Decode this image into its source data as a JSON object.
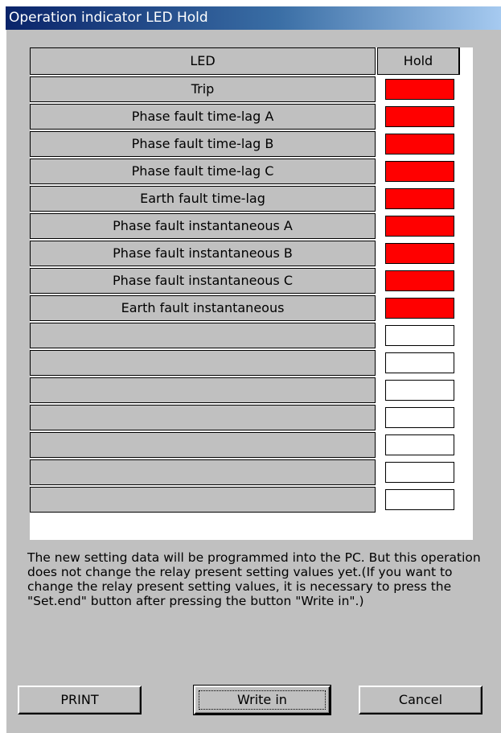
{
  "window": {
    "title": "Operation indicator LED Hold"
  },
  "table": {
    "header_led": "LED",
    "header_hold": "Hold",
    "rows": [
      {
        "label": "Trip",
        "hold": true
      },
      {
        "label": "Phase fault time-lag A",
        "hold": true
      },
      {
        "label": "Phase fault time-lag B",
        "hold": true
      },
      {
        "label": "Phase fault time-lag C",
        "hold": true
      },
      {
        "label": "Earth fault time-lag",
        "hold": true
      },
      {
        "label": "Phase fault instantaneous A",
        "hold": true
      },
      {
        "label": "Phase fault instantaneous B",
        "hold": true
      },
      {
        "label": "Phase fault instantaneous C",
        "hold": true
      },
      {
        "label": "Earth fault instantaneous",
        "hold": true
      },
      {
        "label": "",
        "hold": false
      },
      {
        "label": "",
        "hold": false
      },
      {
        "label": "",
        "hold": false
      },
      {
        "label": "",
        "hold": false
      },
      {
        "label": "",
        "hold": false
      },
      {
        "label": "",
        "hold": false
      },
      {
        "label": "",
        "hold": false
      }
    ]
  },
  "note": "The new setting data will be programmed into the PC. But this operation does not change the relay present setting values yet.(If you want to change the relay present setting values, it is necessary to press the \"Set.end\" button after pressing the button \"Write in\".)",
  "buttons": {
    "print": "PRINT",
    "write_in": "Write in",
    "cancel": "Cancel"
  },
  "colors": {
    "hold_on": "#ff0000",
    "hold_off": "#ffffff",
    "title_bar": "#0a246a"
  }
}
